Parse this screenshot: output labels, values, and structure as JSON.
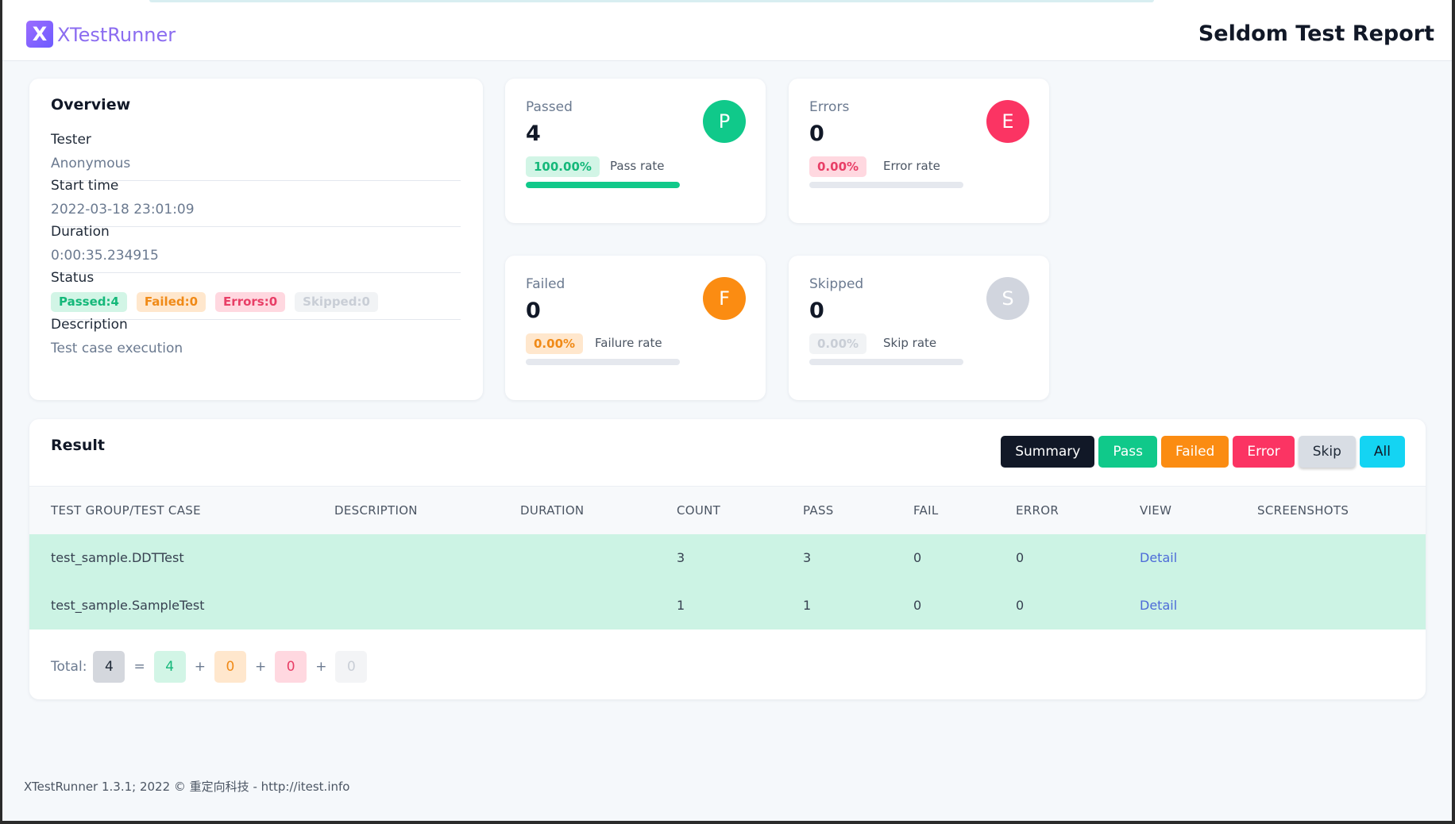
{
  "header": {
    "logo_glyph": "X",
    "logo_text": "XTestRunner",
    "report_title": "Seldom Test Report"
  },
  "overview": {
    "title": "Overview",
    "tester_label": "Tester",
    "tester_value": "Anonymous",
    "start_label": "Start time",
    "start_value": "2022-03-18 23:01:09",
    "duration_label": "Duration",
    "duration_value": "0:00:35.234915",
    "status_label": "Status",
    "status_passed": "Passed:4",
    "status_failed": "Failed:0",
    "status_errors": "Errors:0",
    "status_skipped": "Skipped:0",
    "description_label": "Description",
    "description_value": "Test case execution"
  },
  "stats": {
    "passed": {
      "label": "Passed",
      "count": "4",
      "icon": "P",
      "percent": "100.00%",
      "rate_label": "Pass rate",
      "fill": 1.0,
      "color": "#10c98a"
    },
    "errors": {
      "label": "Errors",
      "count": "0",
      "icon": "E",
      "percent": "0.00%",
      "rate_label": "Error rate",
      "fill": 0.0,
      "color": "#fb3463"
    },
    "failed": {
      "label": "Failed",
      "count": "0",
      "icon": "F",
      "percent": "0.00%",
      "rate_label": "Failure rate",
      "fill": 0.0,
      "color": "#fb8c12"
    },
    "skipped": {
      "label": "Skipped",
      "count": "0",
      "icon": "S",
      "percent": "0.00%",
      "rate_label": "Skip rate",
      "fill": 0.0,
      "color": "#d1d5de"
    }
  },
  "result": {
    "title": "Result",
    "filters": {
      "summary": "Summary",
      "pass": "Pass",
      "failed": "Failed",
      "error": "Error",
      "skip": "Skip",
      "all": "All"
    },
    "columns": {
      "group": "TEST GROUP/TEST CASE",
      "description": "DESCRIPTION",
      "duration": "DURATION",
      "count": "COUNT",
      "pass": "PASS",
      "fail": "FAIL",
      "error": "ERROR",
      "view": "VIEW",
      "screenshots": "SCREENSHOTS"
    },
    "rows": [
      {
        "name": "test_sample.DDTTest",
        "description": "",
        "duration": "",
        "count": "3",
        "pass": "3",
        "fail": "0",
        "error": "0",
        "view": "Detail"
      },
      {
        "name": "test_sample.SampleTest",
        "description": "",
        "duration": "",
        "count": "1",
        "pass": "1",
        "fail": "0",
        "error": "0",
        "view": "Detail"
      }
    ],
    "total": {
      "label": "Total:",
      "all": "4",
      "pass": "4",
      "fail": "0",
      "error": "0",
      "skip": "0",
      "equals": "=",
      "plus": "+"
    }
  },
  "footer": {
    "text": "XTestRunner 1.3.1; 2022 © 重定向科技 - http://itest.info"
  }
}
